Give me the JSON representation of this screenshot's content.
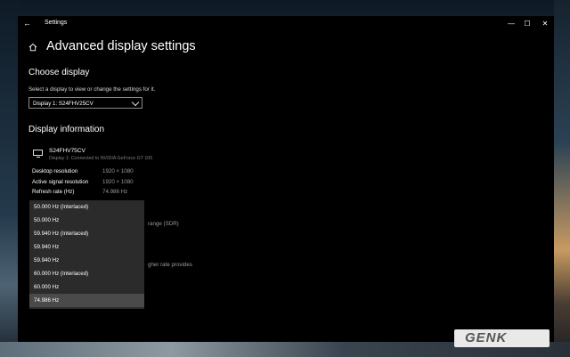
{
  "window": {
    "title": "Settings"
  },
  "titlebar": {
    "back_glyph": "←",
    "min_glyph": "—",
    "max_glyph": "☐",
    "close_glyph": "✕"
  },
  "page": {
    "title": "Advanced display settings"
  },
  "choose_display": {
    "heading": "Choose display",
    "description": "Select a display to view or change the settings for it.",
    "selected": "Display 1: S24FHV25CV"
  },
  "display_info": {
    "heading": "Display information",
    "monitor_name": "S24FHV75CV",
    "monitor_sub": "Display 1: Connected to NVIDIA GeForce GT 105",
    "rows": [
      {
        "label": "Desktop resolution",
        "value": "1920 × 1080"
      },
      {
        "label": "Active signal resolution",
        "value": "1920 × 1080"
      },
      {
        "label": "Refresh rate (Hz)",
        "value": "74.986 Hz"
      }
    ]
  },
  "partial_text": {
    "range": "range (SDR)",
    "refresh_note": "gher rate provides"
  },
  "refresh_dropdown": {
    "options": [
      "50.000 Hz (Interlaced)",
      "50.000 Hz",
      "59.940 Hz (Interlaced)",
      "59.940 Hz",
      "59.940 Hz",
      "60.000 Hz (Interlaced)",
      "60.000 Hz",
      "74.986 Hz"
    ],
    "selected_index": 7
  },
  "watermark": {
    "text": "GENK"
  },
  "icons": {
    "home": "home-icon",
    "monitor": "monitor-icon",
    "chevron": "chevron-down-icon"
  },
  "colors": {
    "window_bg": "#000000",
    "dropdown_bg": "#2b2b2b",
    "selected_bg": "#4a4a4a"
  }
}
